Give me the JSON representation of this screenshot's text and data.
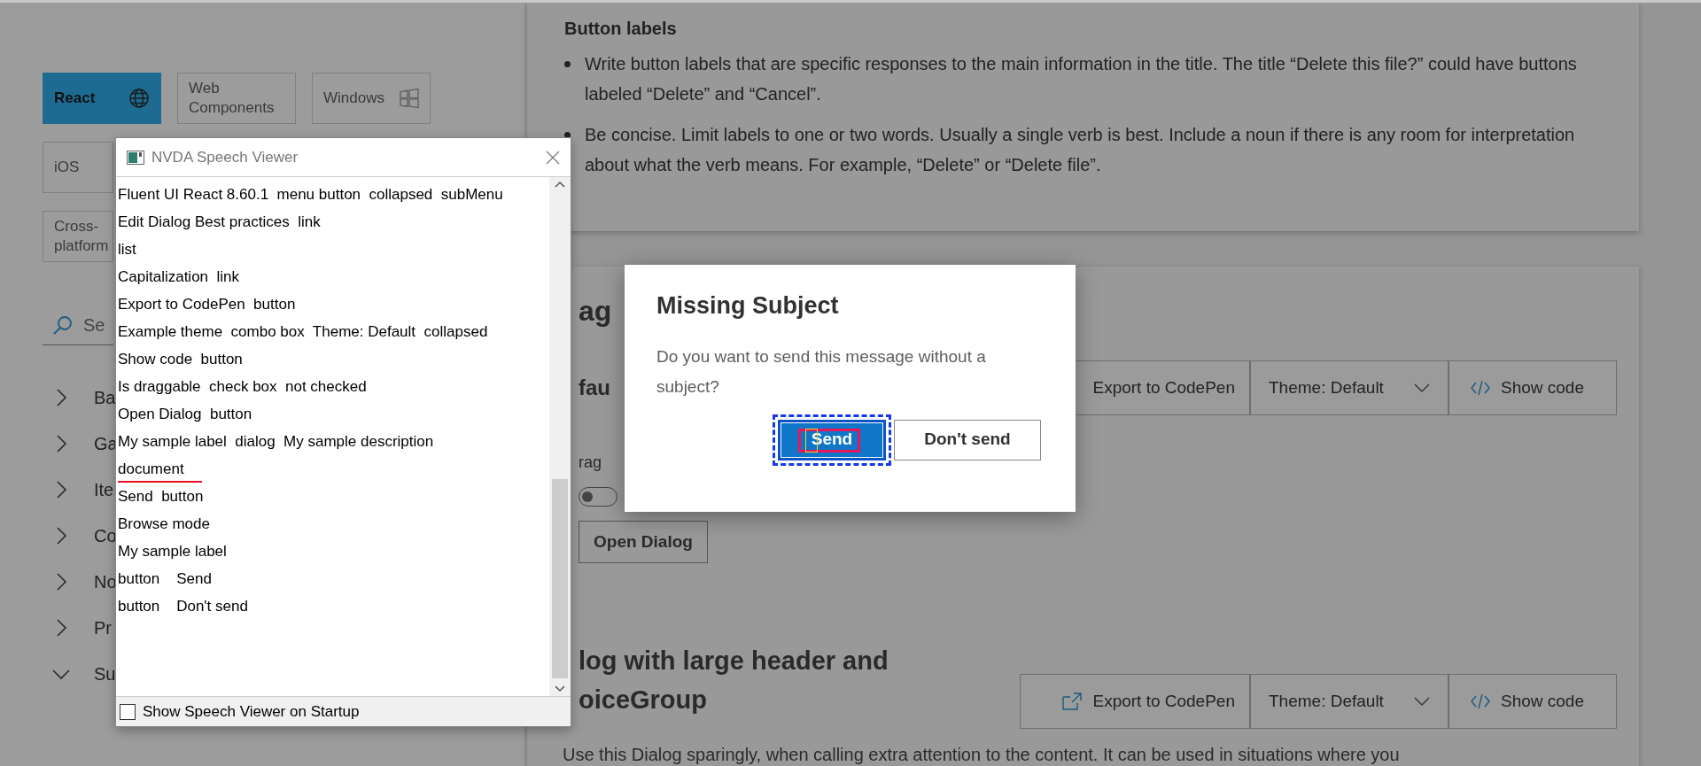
{
  "sidebar": {
    "platform_rows": [
      [
        {
          "label": "React",
          "selected": true
        },
        {
          "label": "Web Components",
          "selected": false
        },
        {
          "label": "Windows",
          "selected": false
        }
      ],
      [
        {
          "label": "iOS",
          "selected": false
        }
      ],
      [
        {
          "label": "Cross-platform",
          "selected": false
        }
      ]
    ],
    "search": {
      "placeholder": "Se"
    },
    "nav": [
      {
        "label": "Ba",
        "expanded": false
      },
      {
        "label": "Ga",
        "expanded": false
      },
      {
        "label": "Ite",
        "expanded": false
      },
      {
        "label": "Co",
        "expanded": false
      },
      {
        "label": "No",
        "expanded": false
      },
      {
        "label": "Pr",
        "expanded": false
      },
      {
        "label": "Su",
        "expanded": true
      }
    ]
  },
  "guidance": {
    "heading": "Button labels",
    "bullets": [
      "Write button labels that are specific responses to the main information in the title. The title “Delete this file?” could have buttons labeled “Delete” and “Cancel”.",
      "Be concise. Limit labels to one or two words. Usually a single verb is best. Include a noun if there is any room for interpretation about what the verb means. For example, “Delete” or “Delete file”."
    ]
  },
  "example": {
    "title": "ag",
    "subtitle": "fau",
    "toolbar": [
      {
        "label": "Export to CodePen",
        "kind": "export",
        "icon_visible": false
      },
      {
        "label": "Theme: Default",
        "kind": "dropdown"
      },
      {
        "label": "Show code",
        "kind": "code"
      }
    ],
    "toggle": {
      "label": "rag",
      "on": false
    },
    "open_button": "Open Dialog"
  },
  "example2": {
    "title_lines": [
      "log with large header and",
      "oiceGroup"
    ],
    "toolbar": [
      {
        "label": "Export to CodePen",
        "kind": "export",
        "icon_visible": true
      },
      {
        "label": "Theme: Default",
        "kind": "dropdown"
      },
      {
        "label": "Show code",
        "kind": "code"
      }
    ],
    "description": "Use this Dialog sparingly, when calling extra attention to the content. It can be used in situations where you"
  },
  "speech_viewer": {
    "title": "NVDA Speech Viewer",
    "lines": [
      {
        "text": "Fluent UI React 8.60.1  menu button  collapsed  subMenu",
        "underlined": false
      },
      {
        "text": "Edit Dialog Best practices  link",
        "underlined": false
      },
      {
        "text": "list",
        "underlined": false
      },
      {
        "text": "Capitalization  link",
        "underlined": false
      },
      {
        "text": "Export to CodePen  button",
        "underlined": false
      },
      {
        "text": "Example theme  combo box  Theme: Default  collapsed",
        "underlined": false
      },
      {
        "text": "Show code  button",
        "underlined": false
      },
      {
        "text": "Is draggable  check box  not checked",
        "underlined": false
      },
      {
        "text": "Open Dialog  button",
        "underlined": false
      },
      {
        "text": "My sample label  dialog  My sample description",
        "underlined": false
      },
      {
        "text": "document",
        "underlined": true
      },
      {
        "text": "Send  button",
        "underlined": false
      },
      {
        "text": "Browse mode",
        "underlined": false
      },
      {
        "text": "My sample label",
        "underlined": false
      },
      {
        "text": "button    Send",
        "underlined": false
      },
      {
        "text": "button    Don't send",
        "underlined": false
      }
    ],
    "startup_checkbox": {
      "label": "Show Speech Viewer on Startup",
      "checked": false
    }
  },
  "dialog": {
    "title": "Missing Subject",
    "message": "Do you want to send this message without a subject?",
    "buttons": [
      {
        "label": "Send",
        "primary": true,
        "focused": true
      },
      {
        "label": "Don't send",
        "primary": false,
        "focused": false
      }
    ]
  }
}
